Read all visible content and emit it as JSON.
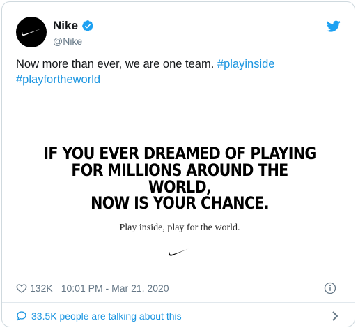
{
  "user": {
    "name": "Nike",
    "handle": "@Nike",
    "avatar_icon": "nike-swoosh-icon",
    "verified_icon": "verified-badge-icon"
  },
  "tweet": {
    "text": "Now more than ever, we are one team.",
    "hashtags": [
      "#playinside",
      "#playfortheworld"
    ]
  },
  "media": {
    "headline_line1": "IF YOU EVER DREAMED OF PLAYING",
    "headline_line2": "FOR MILLIONS AROUND THE WORLD,",
    "headline_line3": "NOW IS YOUR CHANCE.",
    "tagline": "Play inside, play for the world."
  },
  "stats": {
    "likes": "132K",
    "timestamp": "10:01 PM - Mar 21, 2020"
  },
  "footer": {
    "talking_text": "33.5K people are talking about this"
  },
  "colors": {
    "link": "#1b95e0",
    "text": "#14171a",
    "muted": "#657786",
    "border": "#cfd9de"
  }
}
